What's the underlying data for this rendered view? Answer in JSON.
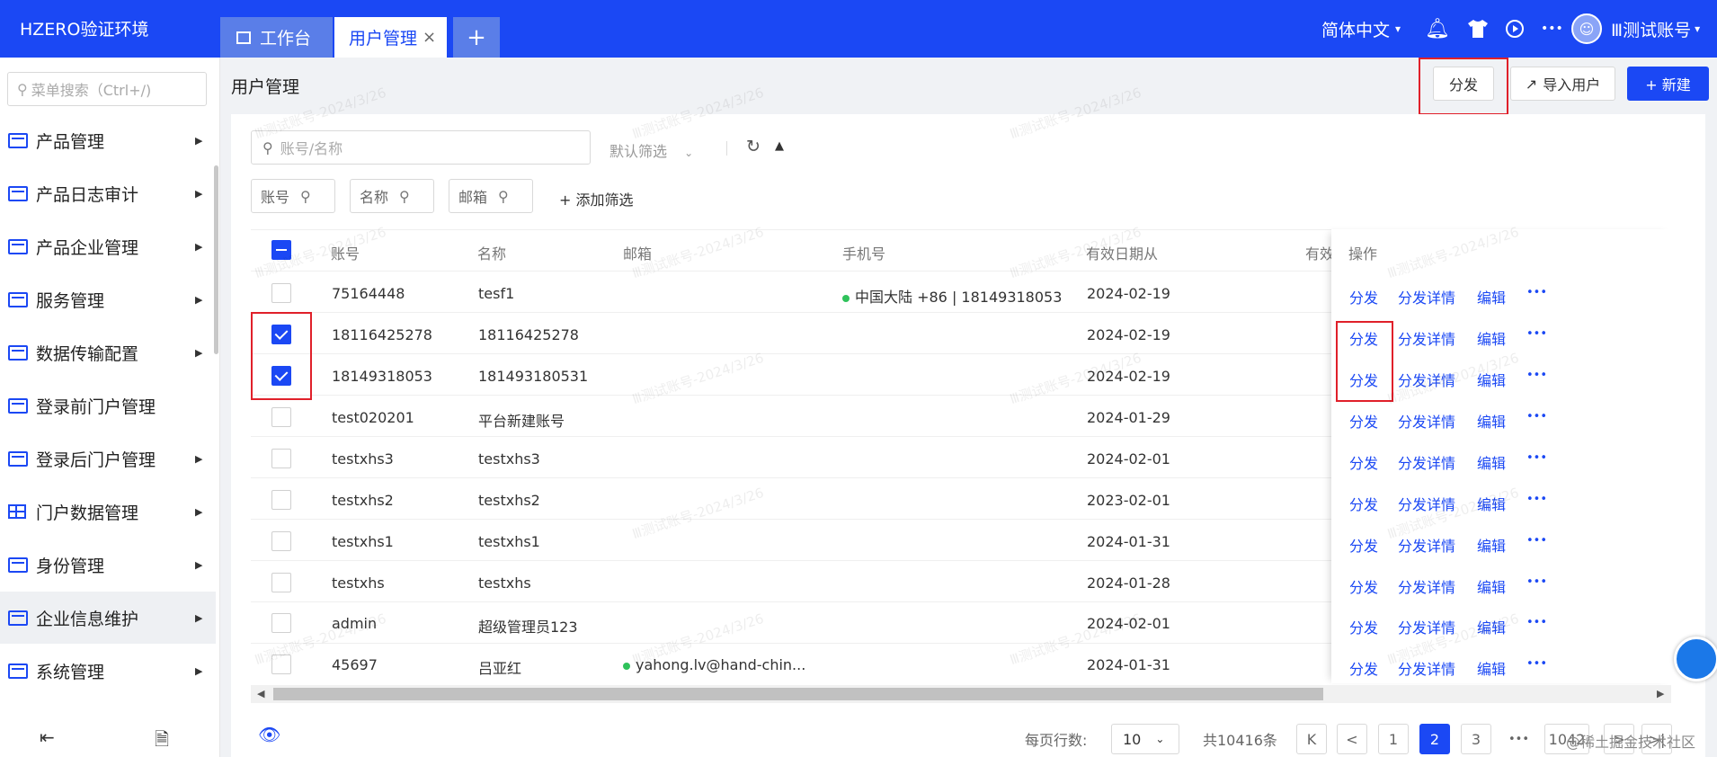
{
  "app": {
    "title": "HZERO验证环境"
  },
  "tabs": [
    {
      "label": "工作台"
    },
    {
      "label": "用户管理",
      "close": "×"
    },
    {
      "label": "+"
    }
  ],
  "topright": {
    "language": "简体中文",
    "more": "•••",
    "user": "Ⅲ测试账号"
  },
  "sidebar": {
    "search_placeholder": "菜单搜索（Ctrl+/)",
    "items": [
      {
        "label": "产品管理"
      },
      {
        "label": "产品日志审计"
      },
      {
        "label": "产品企业管理"
      },
      {
        "label": "服务管理"
      },
      {
        "label": "数据传输配置"
      },
      {
        "label": "登录前门户管理"
      },
      {
        "label": "登录后门户管理"
      },
      {
        "label": "门户数据管理"
      },
      {
        "label": "身份管理"
      },
      {
        "label": "企业信息维护"
      },
      {
        "label": "系统管理"
      }
    ]
  },
  "page": {
    "title": "用户管理"
  },
  "toolbar": {
    "distribute": "分发",
    "import": "导入用户",
    "create": "+ 新建"
  },
  "search": {
    "placeholder": "账号/名称",
    "default_filter": "默认筛选",
    "add_filter": "+ 添加筛选"
  },
  "chips": [
    "账号",
    "名称",
    "邮箱"
  ],
  "table": {
    "columns": [
      "账号",
      "名称",
      "邮箱",
      "手机号",
      "有效日期从",
      "有效",
      "操作"
    ],
    "rows": [
      {
        "account": "75164448",
        "name": "tesf1",
        "email": "",
        "phone": "中国大陆 +86 | 18149318053",
        "date": "2024-02-19",
        "checked": false
      },
      {
        "account": "18116425278",
        "name": "18116425278",
        "email": "",
        "phone": "",
        "date": "2024-02-19",
        "checked": true
      },
      {
        "account": "18149318053",
        "name": "181493180531",
        "email": "",
        "phone": "",
        "date": "2024-02-19",
        "checked": true
      },
      {
        "account": "test020201",
        "name": "平台新建账号",
        "email": "",
        "phone": "",
        "date": "2024-01-29",
        "checked": false
      },
      {
        "account": "testxhs3",
        "name": "testxhs3",
        "email": "",
        "phone": "",
        "date": "2024-02-01",
        "checked": false
      },
      {
        "account": "testxhs2",
        "name": "testxhs2",
        "email": "",
        "phone": "",
        "date": "2023-02-01",
        "checked": false
      },
      {
        "account": "testxhs1",
        "name": "testxhs1",
        "email": "",
        "phone": "",
        "date": "2024-01-31",
        "checked": false
      },
      {
        "account": "testxhs",
        "name": "testxhs",
        "email": "",
        "phone": "",
        "date": "2024-01-28",
        "checked": false
      },
      {
        "account": "admin",
        "name": "超级管理员123",
        "email": "",
        "phone": "",
        "date": "2024-02-01",
        "checked": false
      },
      {
        "account": "45697",
        "name": "吕亚红",
        "email": "yahong.lv@hand-chin...",
        "phone": "",
        "date": "2024-01-31",
        "checked": false
      }
    ],
    "ops": {
      "distribute": "分发",
      "details": "分发详情",
      "edit": "编辑",
      "more": "•••"
    }
  },
  "pagination": {
    "rows_per_page_label": "每页行数:",
    "rows_per_page": "10",
    "total": "共10416条",
    "first": "K",
    "prev": "<",
    "pages": [
      "1",
      "2",
      "3"
    ],
    "ellipsis": "•••",
    "last_page": "1042",
    "next": ">",
    "end": ">|"
  },
  "watermark": "Ⅲ测试账号-2024/3/26",
  "corner_text": "@稀土掘金技术社区",
  "colors": {
    "primary": "#1b48f4",
    "highlight": "#e0202a",
    "status_dot": "#2fc25b"
  }
}
